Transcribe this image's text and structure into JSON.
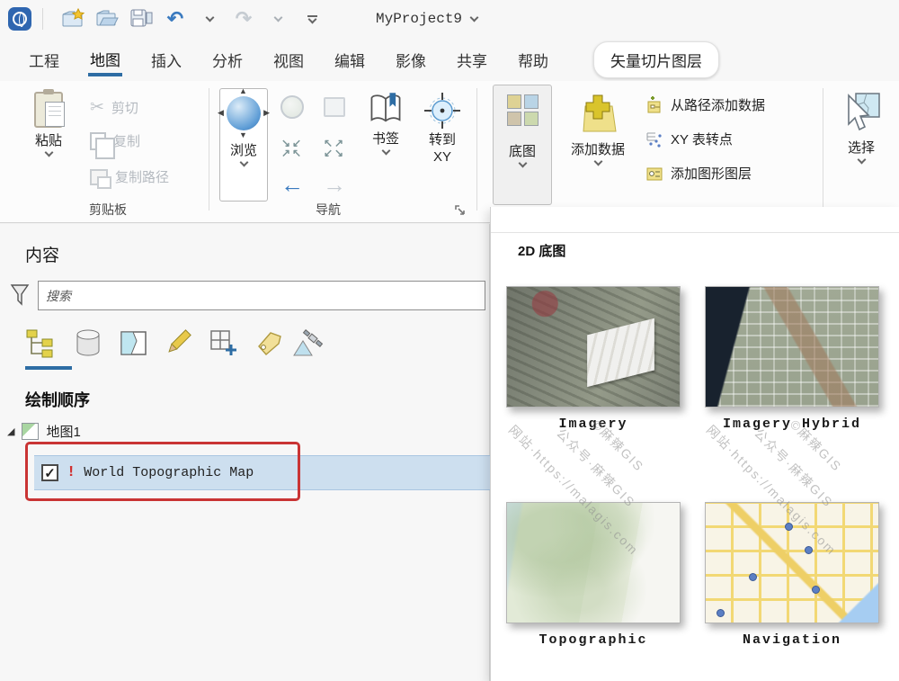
{
  "titlebar": {
    "project_title": "MyProject9"
  },
  "tabs": {
    "items": [
      {
        "label": "工程",
        "active": false
      },
      {
        "label": "地图",
        "active": true
      },
      {
        "label": "插入",
        "active": false
      },
      {
        "label": "分析",
        "active": false
      },
      {
        "label": "视图",
        "active": false
      },
      {
        "label": "编辑",
        "active": false
      },
      {
        "label": "影像",
        "active": false
      },
      {
        "label": "共享",
        "active": false
      },
      {
        "label": "帮助",
        "active": false
      }
    ],
    "contextual": "矢量切片图层"
  },
  "ribbon": {
    "clipboard": {
      "paste": "粘贴",
      "cut": "剪切",
      "copy": "复制",
      "copy_path": "复制路径",
      "group": "剪贴板"
    },
    "navigation": {
      "explore": "浏览",
      "bookmarks": "书签",
      "goto_line1": "转到",
      "goto_line2": "XY",
      "group": "导航"
    },
    "layer": {
      "basemap": "底图",
      "add_data": "添加数据",
      "add_from_path": "从路径添加数据",
      "xy_table": "XY 表转点",
      "add_graphics": "添加图形图层"
    },
    "selection": {
      "select": "选择"
    }
  },
  "contents_panel": {
    "title": "内容",
    "search_placeholder": "搜索",
    "section": "绘制顺序",
    "map_item": "地图1",
    "layer_item": "World Topographic Map"
  },
  "gallery": {
    "header": "2D 底图",
    "items": [
      {
        "label": "Imagery"
      },
      {
        "label": "Imagery Hybrid"
      },
      {
        "label": "Topographic"
      },
      {
        "label": "Navigation"
      }
    ]
  },
  "watermark": {
    "line1": "©麻辣GIS",
    "line2": "公众号·麻辣GIS",
    "line3": "网站·https://malagis.com"
  },
  "icons": {
    "undo": "↶",
    "redo": "↷",
    "cut": "✂",
    "prev_extent": "←",
    "next_extent": "→",
    "zoom_in_row1": "↘↙",
    "zoom_in_row2": "↗↖",
    "zoom_out_row1": "↖↗",
    "zoom_out_row2": "↙↘",
    "sphere_n": "▲",
    "sphere_s": "▼",
    "sphere_w": "◀",
    "sphere_e": "▶",
    "expander_open": "◢",
    "check": "✓",
    "warning": "!"
  },
  "colors": {
    "accent": "#2e6da4",
    "selection_bg": "#cddfef",
    "annotation": "#c93434",
    "disabled": "#b5bac0"
  }
}
